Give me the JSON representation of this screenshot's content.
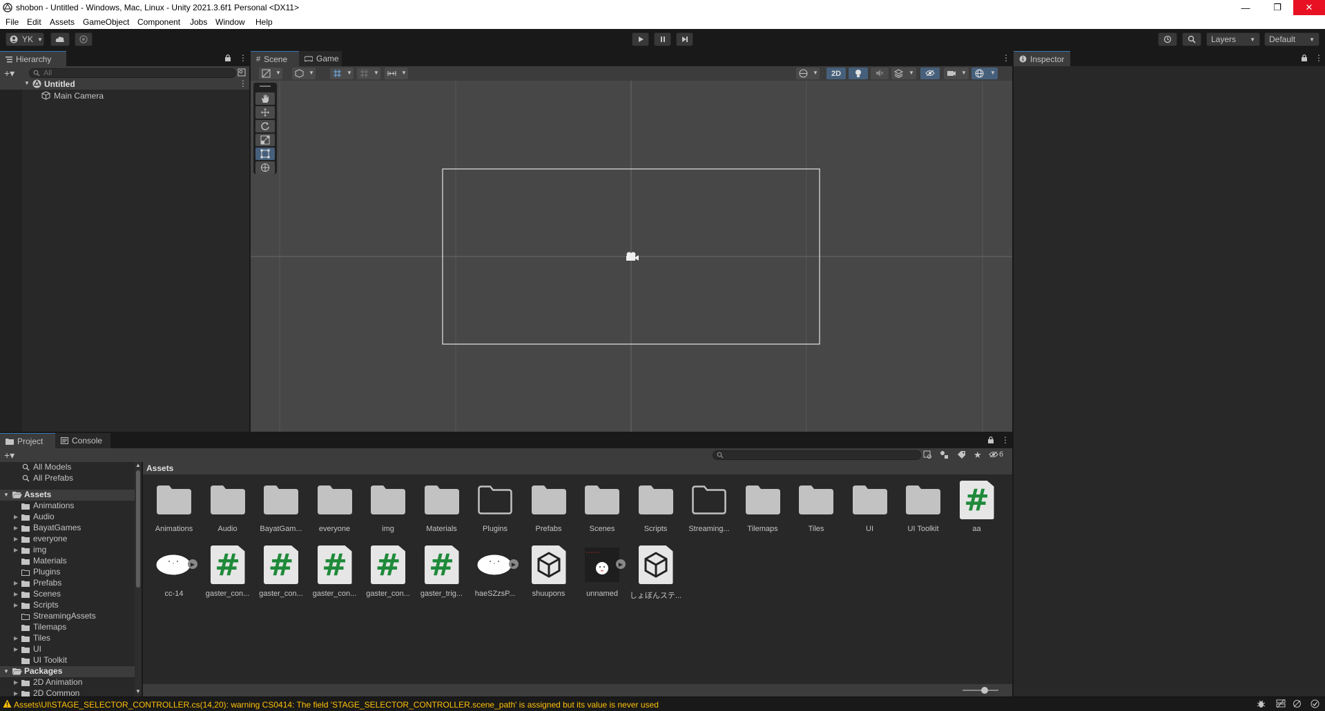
{
  "window": {
    "title": "shobon - Untitled - Windows, Mac, Linux - Unity 2021.3.6f1 Personal <DX11>",
    "minimize": "—",
    "restore": "❐",
    "close": "✕"
  },
  "menu": [
    "File",
    "Edit",
    "Assets",
    "GameObject",
    "Component",
    "Jobs",
    "Window",
    "Help"
  ],
  "toolbar": {
    "account": "YK",
    "layers": "Layers",
    "layout": "Default"
  },
  "hierarchy": {
    "tab": "Hierarchy",
    "search_placeholder": "All",
    "scene": "Untitled",
    "items": [
      "Main Camera"
    ]
  },
  "scene": {
    "tabs": [
      "Scene",
      "Game"
    ],
    "mode_2d": "2D"
  },
  "inspector": {
    "tab": "Inspector"
  },
  "project": {
    "tabs": [
      "Project",
      "Console"
    ],
    "breadcrumb": "Assets",
    "hidden_count": "6",
    "favorites": [
      "All Models",
      "All Prefabs"
    ],
    "tree": {
      "assets_root": "Assets",
      "assets_children": [
        "Animations",
        "Audio",
        "BayatGames",
        "everyone",
        "img",
        "Materials",
        "Plugins",
        "Prefabs",
        "Scenes",
        "Scripts",
        "StreamingAssets",
        "Tilemaps",
        "Tiles",
        "UI",
        "UI Toolkit"
      ],
      "packages_root": "Packages",
      "packages_children": [
        "2D Animation",
        "2D Common"
      ]
    },
    "assets_row1": [
      "Animations",
      "Audio",
      "BayatGam...",
      "everyone",
      "img",
      "Materials",
      "Plugins",
      "Prefabs",
      "Scenes",
      "Scripts",
      "Streaming...",
      "Tilemaps",
      "Tiles",
      "UI",
      "UI Toolkit",
      "aa"
    ],
    "assets_row2": [
      "cc-14",
      "gaster_con...",
      "gaster_con...",
      "gaster_con...",
      "gaster_con...",
      "gaster_trig...",
      "haeSZzsP...",
      "shuupons",
      "unnamed",
      "しょぼんステ..."
    ]
  },
  "status": {
    "message": "Assets\\UI\\STAGE_SELECTOR_CONTROLLER.cs(14,20): warning CS0414: The field 'STAGE_SELECTOR_CONTROLLER.scene_path' is assigned but its value is never used"
  },
  "colors": {
    "accent": "#3a79bb",
    "warning": "#ffc107",
    "csharp_hash": "#1f8a3a"
  }
}
